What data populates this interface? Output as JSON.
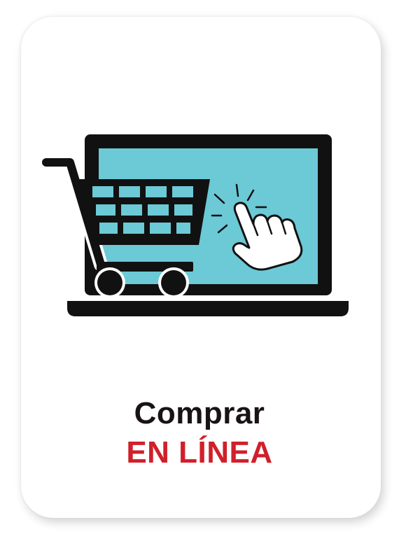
{
  "card": {
    "title_line1": "Comprar",
    "title_line2": "EN LÍNEA"
  },
  "colors": {
    "screen": "#6cc9d6",
    "outline": "#111111",
    "title_dark": "#1a1313",
    "title_accent": "#d0202a"
  },
  "icons": [
    "laptop-icon",
    "shopping-cart-icon",
    "pointing-hand-icon"
  ]
}
